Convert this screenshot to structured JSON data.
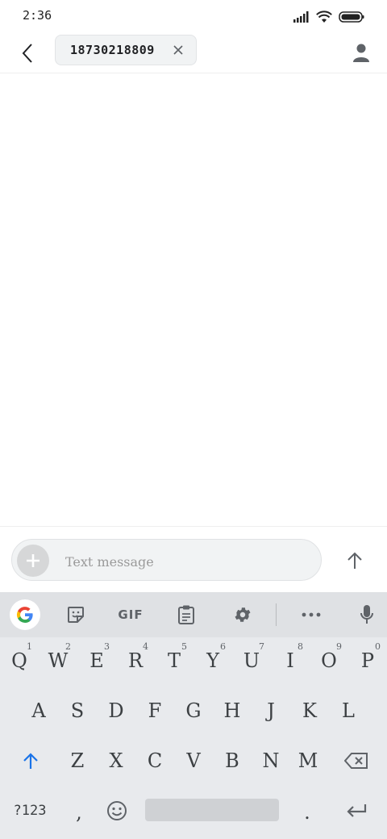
{
  "status": {
    "time": "2:36",
    "icons": [
      "signal-icon",
      "wifi-icon",
      "battery-icon"
    ]
  },
  "header": {
    "recipient": "18730218809"
  },
  "compose": {
    "placeholder": "Text message"
  },
  "keyboard": {
    "toolbar": {
      "gif_label": "GIF"
    },
    "row1": [
      {
        "key": "Q",
        "hint": "1"
      },
      {
        "key": "W",
        "hint": "2"
      },
      {
        "key": "E",
        "hint": "3"
      },
      {
        "key": "R",
        "hint": "4"
      },
      {
        "key": "T",
        "hint": "5"
      },
      {
        "key": "Y",
        "hint": "6"
      },
      {
        "key": "U",
        "hint": "7"
      },
      {
        "key": "I",
        "hint": "8"
      },
      {
        "key": "O",
        "hint": "9"
      },
      {
        "key": "P",
        "hint": "0"
      }
    ],
    "row2": [
      "A",
      "S",
      "D",
      "F",
      "G",
      "H",
      "J",
      "K",
      "L"
    ],
    "row3": [
      "Z",
      "X",
      "C",
      "V",
      "B",
      "N",
      "M"
    ],
    "symbols_label": "?123",
    "comma": ",",
    "period": "."
  },
  "colors": {
    "accent": "#1a73e8",
    "keyboard_bg": "#e8eaed",
    "toolbar_bg": "#dfe1e4"
  }
}
